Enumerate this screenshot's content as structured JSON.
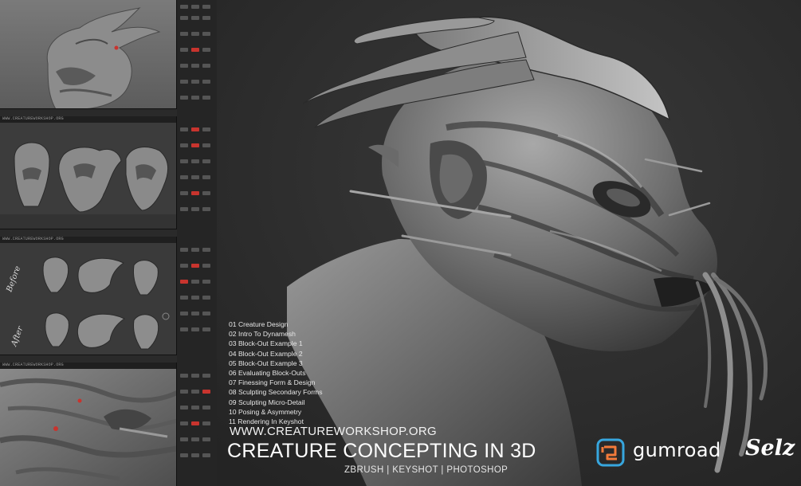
{
  "screenshots": {
    "url_label": "WWW.CREATUREWORKSHOP.ORG",
    "annotation_before": "Before",
    "annotation_after": "After"
  },
  "chapters": [
    "01 Creature Design",
    "02 Intro To Dynamesh",
    "03 Block-Out Example 1",
    "04 Block-Out Example 2",
    "05 Block-Out Example 3",
    "06 Evaluating Block-Outs",
    "07 Finessing Form & Design",
    "08 Sculpting Secondary Forms",
    "09 Sculpting Micro-Detail",
    "10 Posing & Asymmetry",
    "11 Rendering In Keyshot"
  ],
  "website": "WWW.CREATUREWORKSHOP.ORG",
  "title": "CREATURE CONCEPTING IN 3D",
  "tools_line": "ZBRUSH | KEYSHOT | PHOTOSHOP",
  "stores": {
    "gumroad": "gumroad",
    "selz": "Selz"
  },
  "colors": {
    "background": "#2e2e2e",
    "gumroad_orange": "#f27a3a",
    "gumroad_blue": "#37a6de",
    "highlight_red": "#c8342e"
  }
}
